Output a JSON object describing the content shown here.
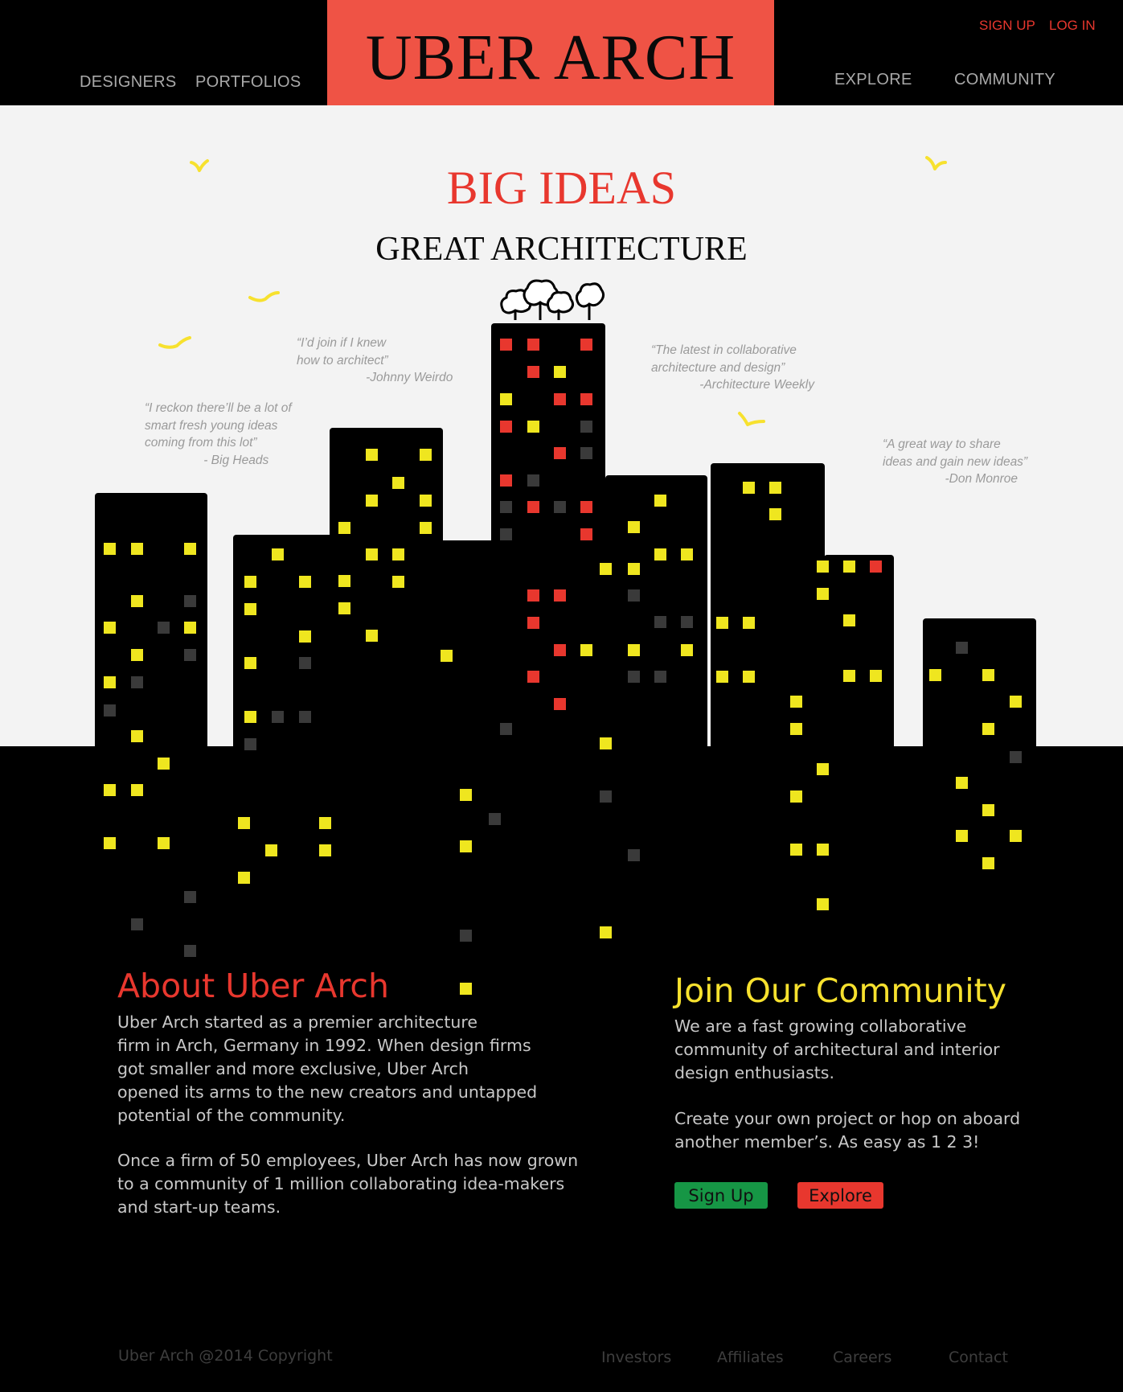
{
  "brand": {
    "name": "UBER ARCH",
    "accent": "#ef5345"
  },
  "header": {
    "nav_left": [
      "DESIGNERS",
      "PORTFOLIOS"
    ],
    "nav_right": [
      "EXPLORE",
      "COMMUNITY"
    ],
    "signup": "SIGN UP",
    "login": "LOG IN"
  },
  "hero": {
    "title": "BIG IDEAS",
    "subtitle": "GREAT ARCHITECTURE",
    "quotes": [
      {
        "text": "“I’d join if I knew\nhow to architect”\n                    -Johnny Weirdo"
      },
      {
        "text": "“I reckon there’ll be a lot of\nsmart fresh young ideas\ncoming from this lot”\n                 - Big Heads"
      },
      {
        "text": "“The latest in collaborative\narchitecture and design”\n              -Architecture Weekly"
      },
      {
        "text": "“A great way to share\nideas and gain new ideas”\n                  -Don Monroe"
      }
    ]
  },
  "about": {
    "title": "About Uber Arch",
    "p1": "Uber Arch started as a premier architecture\nfirm in Arch, Germany in 1992. When design firms\ngot smaller and more exclusive, Uber Arch\nopened its arms to the new creators and untapped\npotential of the community.",
    "p2": "Once a firm of 50 employees, Uber Arch has now grown\nto a community of 1 million collaborating idea-makers\nand start-up teams."
  },
  "community": {
    "title": "Join Our Community",
    "p1": "We are a fast growing collaborative\ncommunity of architectural and interior\ndesign enthusiasts.",
    "p2": "Create your own project or hop on aboard\nanother member’s. As easy as 1 2 3!",
    "signup_button": "Sign Up",
    "explore_button": "Explore",
    "signup_color": "#169645",
    "explore_color": "#e8372e"
  },
  "footer": {
    "copyright": "Uber Arch @2014 Copyright",
    "links": [
      "Investors",
      "Affiliates",
      "Careers",
      "Contact"
    ]
  },
  "colors": {
    "title_red": "#e8372e",
    "title_yellow": "#f7e12e",
    "window_yellow": "#efe61f",
    "window_red": "#e8372e",
    "window_dark": "#3a3a3a"
  },
  "icons": [
    "bird-icon",
    "tree-icon"
  ]
}
